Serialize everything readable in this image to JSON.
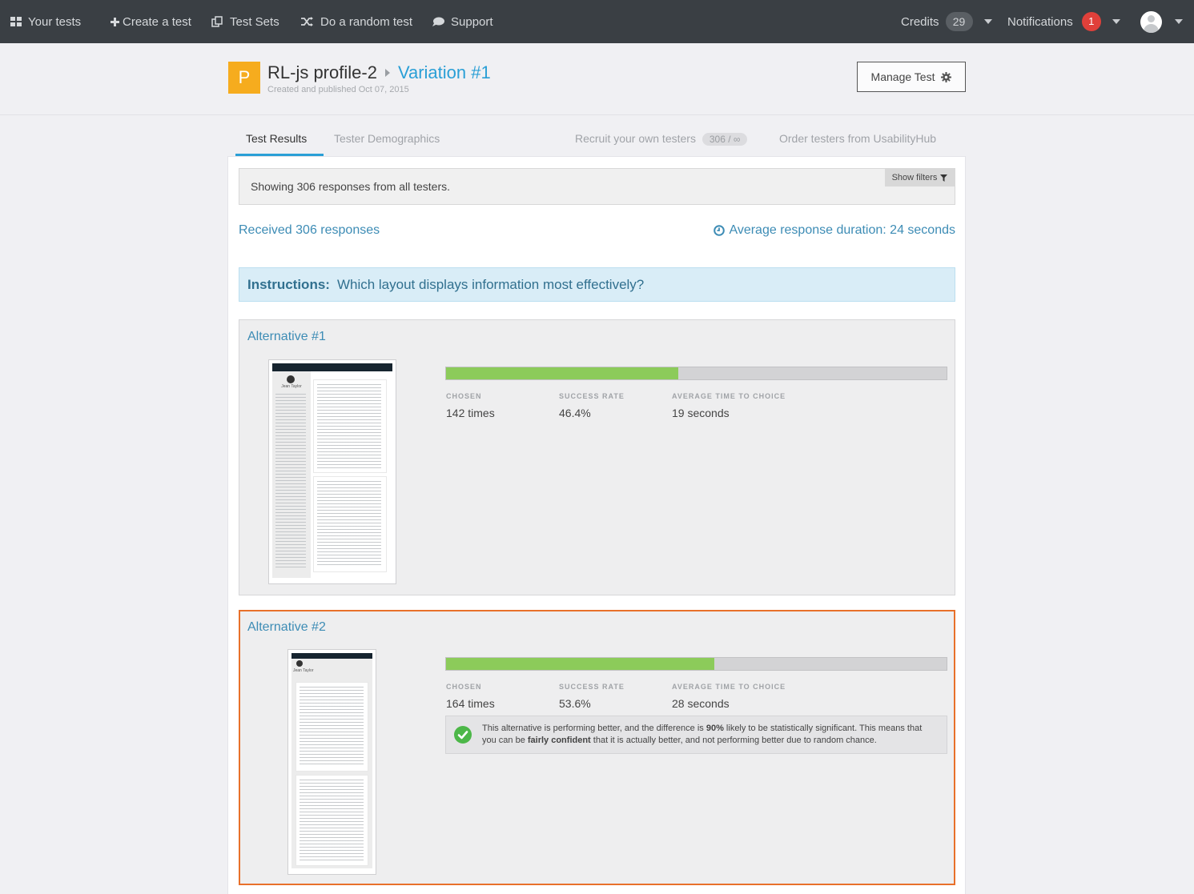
{
  "nav": {
    "your_tests": "Your tests",
    "create_test": "Create a test",
    "test_sets": "Test Sets",
    "random_test": "Do a random test",
    "support": "Support",
    "credits_label": "Credits",
    "credits_count": "29",
    "notifications_label": "Notifications",
    "notifications_count": "1"
  },
  "header": {
    "logo_letter": "P",
    "test_name": "RL-js profile-2",
    "variation": "Variation #1",
    "subtitle": "Created and published Oct 07, 2015",
    "manage_button": "Manage Test"
  },
  "tabs": {
    "results": "Test Results",
    "demographics": "Tester Demographics",
    "recruit": "Recruit your own testers",
    "recruit_pill": "306 / ∞",
    "order": "Order testers from UsabilityHub"
  },
  "filters": {
    "showing": "Showing 306 responses from all testers.",
    "button": "Show filters"
  },
  "summary": {
    "received": "Received 306 responses",
    "avg_duration": "Average response duration: 24 seconds"
  },
  "instructions": {
    "label": "Instructions:",
    "text": "Which layout displays information most effectively?"
  },
  "stat_labels": {
    "chosen": "CHOSEN",
    "success": "SUCCESS RATE",
    "avg_time": "AVERAGE TIME TO CHOICE"
  },
  "alternatives": [
    {
      "title": "Alternative #1",
      "chosen": "142 times",
      "success_rate": "46.4%",
      "success_fraction": 0.464,
      "avg_time": "19 seconds"
    },
    {
      "title": "Alternative #2",
      "chosen": "164 times",
      "success_rate": "53.6%",
      "success_fraction": 0.536,
      "avg_time": "28 seconds",
      "notice_a": "This alternative is performing better, and the difference is ",
      "notice_pct": "90%",
      "notice_b": " likely to be statistically significant. This means that you can be ",
      "notice_conf": "fairly confident",
      "notice_c": " that it is actually better, and not performing better due to random chance."
    }
  ],
  "thumb_text": {
    "name": "Jean Taylor"
  },
  "colors": {
    "nav_bg": "#3a3f44",
    "accent": "#2a9fd6",
    "bar_fill": "#8ccb5a",
    "highlight_border": "#e8702a",
    "logo": "#f6ac1e"
  }
}
